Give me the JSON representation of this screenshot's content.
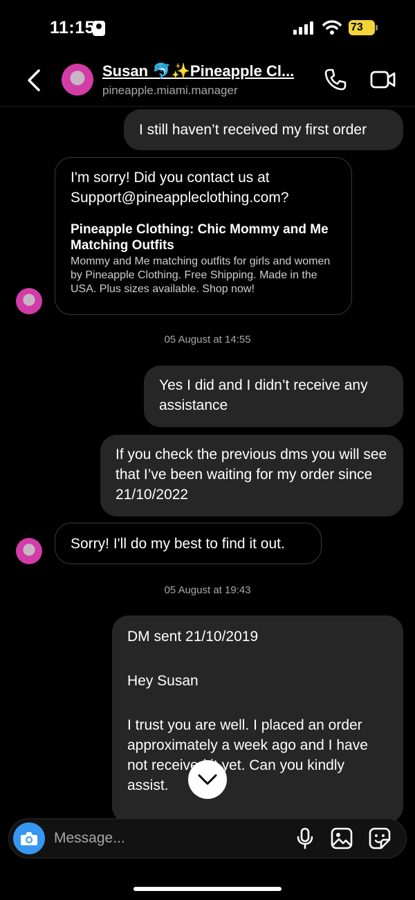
{
  "status_bar": {
    "time": "11:15",
    "battery": "73"
  },
  "header": {
    "contact_name": "Susan 🐬✨Pineapple Cl...",
    "contact_username": "pineapple.miami.manager"
  },
  "messages": {
    "m1": "I still haven’t received my first order",
    "m2": {
      "line": "I'm sorry! Did you contact us at Support@pineappleclothing.com?",
      "link_title": "Pineapple Clothing: Chic Mommy and Me Matching Outfits",
      "link_desc": "Mommy and Me matching outfits for girls and women by Pineapple Clothing. Free Shipping. Made in the USA. Plus sizes available. Shop now!"
    },
    "ts1": "05 August at 14:55",
    "m3": "Yes I did and I didn’t receive any assistance",
    "m4": "If you check the previous dms you will see that I’ve been waiting for my order since 21/10/2022",
    "m5": "Sorry! I'll do my best to find it out.",
    "ts2": "05 August at 19:43",
    "m6": {
      "p1": "DM sent 21/10/2019",
      "p2": "Hey Susan",
      "p3": "I trust you are well. I placed an order approximately a week ago and I have not received it yet. Can you kindly assist."
    }
  },
  "composer": {
    "placeholder": "Message..."
  },
  "icons": {
    "back": "chevron-left-icon",
    "call": "phone-icon",
    "video": "video-camera-icon",
    "scroll": "chevron-down-icon",
    "camera": "camera-icon",
    "mic": "microphone-icon",
    "gallery": "image-icon",
    "sticker": "sticker-icon"
  },
  "colors": {
    "accent": "#3797f0",
    "bubble_me": "#262626",
    "battery": "#f2d43a",
    "background": "#000000"
  }
}
